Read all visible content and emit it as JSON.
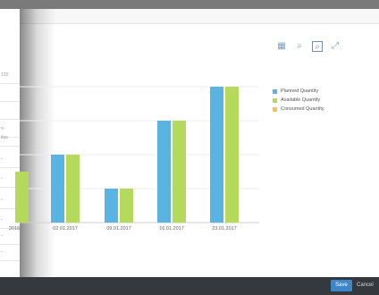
{
  "background": {
    "left_rows": [
      {
        "text": "120",
        "red": false
      },
      {
        "text": "",
        "red": false
      },
      {
        "text": "",
        "red": false
      },
      {
        "text": "o-",
        "red": false
      },
      {
        "text": "itus",
        "red": false
      },
      {
        "text": "-",
        "red": true
      },
      {
        "text": "-",
        "red": true
      },
      {
        "text": "-",
        "red": true
      },
      {
        "text": "-",
        "red": true
      },
      {
        "text": "-",
        "red": true
      },
      {
        "text": "-",
        "red": true
      }
    ]
  },
  "toolbar": {
    "icons": [
      "table-icon",
      "zoom-in-icon",
      "zoom-out-icon",
      "fullscreen-icon"
    ]
  },
  "chart_data": {
    "type": "bar",
    "categories": [
      "2016",
      "02.01.2017",
      "09.01.2017",
      "16.01.2017",
      "23.01.2017"
    ],
    "series": [
      {
        "name": "Planned Quantity",
        "color": "#5ab4e1",
        "values": [
          null,
          2,
          1,
          3,
          4
        ]
      },
      {
        "name": "Available Quantity",
        "color": "#b5d95a",
        "values": [
          1.5,
          2,
          1,
          3,
          4
        ]
      },
      {
        "name": "Consumed Quantity",
        "color": "#f1c35c",
        "values": [
          null,
          null,
          null,
          null,
          null
        ]
      }
    ],
    "ylim": [
      0,
      4
    ],
    "grid": true,
    "legend": "right"
  },
  "footer": {
    "save_label": "Save",
    "cancel_label": "Cancel"
  }
}
